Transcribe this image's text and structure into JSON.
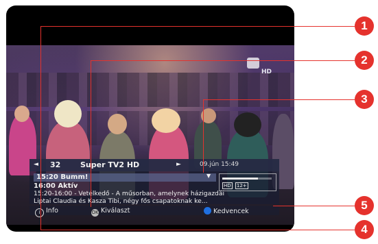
{
  "channel_logo": {
    "hd": "HD"
  },
  "infobar": {
    "nav_left": "◄",
    "channel_number": "32",
    "channel_name": "Super TV2 HD",
    "nav_right": "►",
    "datetime": "09.jún 15:49",
    "scroll_arrow": "▼",
    "current_program": "15:20 Bumm!",
    "next_program": "16:00 Aktív",
    "description_line1": "15:20-16:00 - Vetélkedő - A műsorban, amelynek házigazdái",
    "description_line2": "Liptai Claudia és Kasza Tibi, négy fős csapatoknak ke...",
    "progress_fraction": 0.72,
    "tag_hd": "HD",
    "tag_age": "12+"
  },
  "legend": {
    "info_icon": "i",
    "info_label": "Info",
    "ok_icon": "OK",
    "ok_label": "Kiválaszt",
    "favorites_label": "Kedvencek"
  },
  "colors": {
    "callout": "#e5322d",
    "favorites_dot": "#1f6fe0"
  },
  "callouts": [
    "1",
    "2",
    "3",
    "4",
    "5"
  ]
}
